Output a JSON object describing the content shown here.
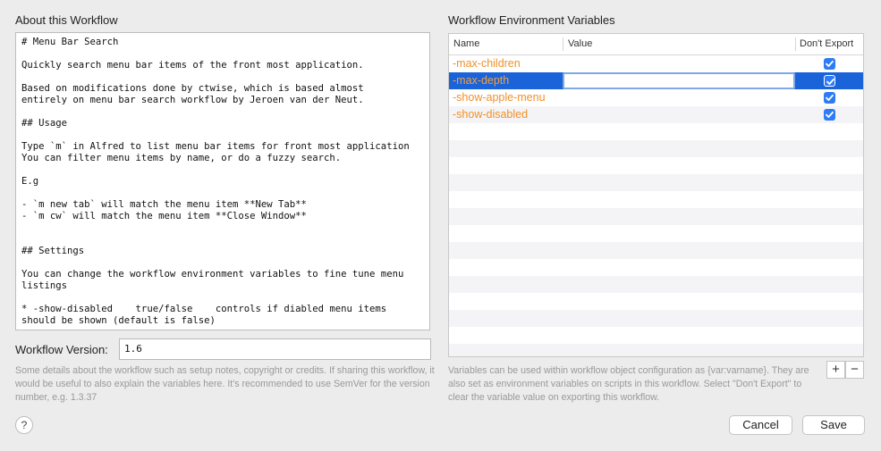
{
  "about": {
    "title": "About this Workflow",
    "notes": "# Menu Bar Search\n\nQuickly search menu bar items of the front most application.\n\nBased on modifications done by ctwise, which is based almost\nentirely on menu bar search workflow by Jeroen van der Neut.\n\n## Usage\n\nType `m` in Alfred to list menu bar items for front most application\nYou can filter menu items by name, or do a fuzzy search.\n\nE.g\n\n- `m new tab` will match the menu item **New Tab**\n- `m cw` will match the menu item **Close Window**\n\n\n## Settings\n\nYou can change the workflow environment variables to fine tune menu\nlistings\n\n* -show-disabled    true/false    controls if diabled menu items\nshould be shown (default is false)",
    "version_label": "Workflow Version:",
    "version_value": "1.6",
    "help_text": "Some details about the workflow such as setup notes, copyright or credits. If sharing this workflow, it would be useful to also explain the variables here. It's recommended to use SemVer for the version number, e.g. 1.3.37",
    "help_button": "?"
  },
  "env": {
    "title": "Workflow Environment Variables",
    "columns": {
      "name": "Name",
      "value": "Value",
      "dont_export": "Don't Export"
    },
    "rows": [
      {
        "name": "-max-children",
        "value": "",
        "dont_export": true
      },
      {
        "name": "-max-depth",
        "value": "",
        "dont_export": true
      },
      {
        "name": "-show-apple-menu",
        "value": "",
        "dont_export": true
      },
      {
        "name": "-show-disabled",
        "value": "",
        "dont_export": true
      }
    ],
    "selected_row": 1,
    "add_label": "+",
    "remove_label": "−",
    "help_text": "Variables can be used within workflow object configuration as {var:varname}. They are also set as environment variables on scripts in this workflow. Select \"Don't Export\" to clear the variable value on exporting this workflow."
  },
  "footer": {
    "cancel_label": "Cancel",
    "save_label": "Save"
  },
  "colors": {
    "accent": "#1a63d8",
    "variable_name": "#f0902a",
    "checkbox": "#2d7cf6"
  }
}
